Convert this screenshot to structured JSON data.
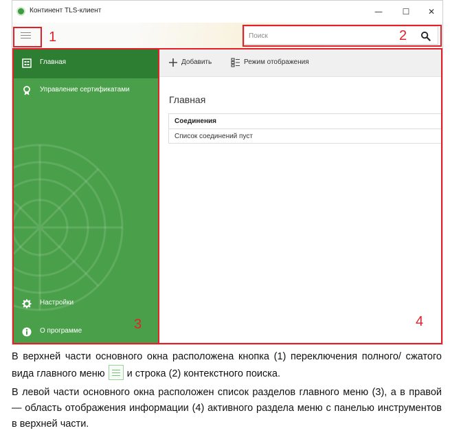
{
  "window": {
    "title": "Континент TLS-клиент",
    "controls": {
      "minimize": "—",
      "maximize": "☐",
      "close": "✕"
    }
  },
  "header": {
    "search": {
      "placeholder": "Поиск",
      "value": ""
    }
  },
  "sidebar": {
    "items": [
      {
        "label": "Главная",
        "icon": "home-icon",
        "active": true
      },
      {
        "label": "Управление сертификатами",
        "icon": "certificate-icon",
        "active": false
      },
      {
        "label": "Настройки",
        "icon": "gear-icon",
        "active": false
      },
      {
        "label": "О программе",
        "icon": "info-icon",
        "active": false
      }
    ]
  },
  "toolbar": {
    "add_label": "Добавить",
    "view_mode_label": "Режим отображения"
  },
  "main": {
    "title": "Главная",
    "table": {
      "header": "Соединения",
      "empty_text": "Список соединений пуст"
    }
  },
  "annotations": {
    "n1": "1",
    "n2": "2",
    "n3": "3",
    "n4": "4"
  },
  "description": {
    "p1_before": "В верхней части основного окна расположена кнопка (1) переключения пол­ного/ сжатого вида главного меню",
    "p1_after": "и строка (2) контекстного поиска.",
    "p2": "В левой части основного окна расположен список разделов главного меню (3), а в правой — область отображения информации (4) активного раздела меню с па­нелью инструментов в верхней части."
  },
  "colors": {
    "sidebar_green": "#4aa04a",
    "sidebar_active": "#2d7d33",
    "annotation_red": "#e3202a"
  }
}
